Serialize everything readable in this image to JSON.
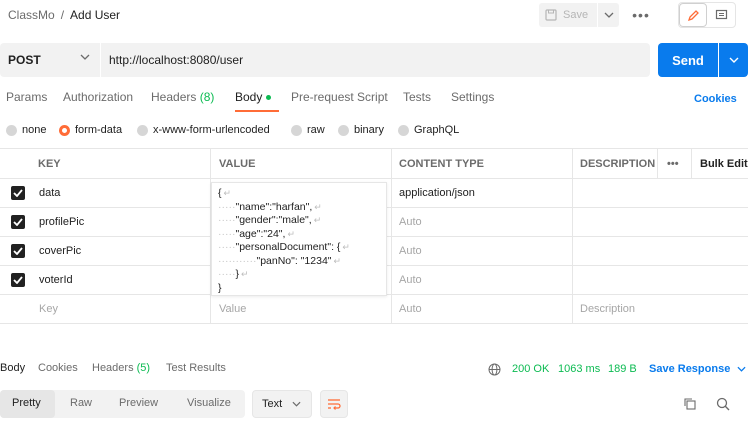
{
  "breadcrumb": {
    "collection": "ClassMo",
    "separator": "/",
    "request": "Add User"
  },
  "toolbar": {
    "save_label": "Save",
    "more": "•••"
  },
  "request": {
    "method": "POST",
    "url": "http://localhost:8080/user",
    "send_label": "Send"
  },
  "tabs": [
    {
      "label": "Params"
    },
    {
      "label": "Authorization"
    },
    {
      "label": "Headers",
      "count": "(8)"
    },
    {
      "label": "Body"
    },
    {
      "label": "Pre-request Script"
    },
    {
      "label": "Tests"
    },
    {
      "label": "Settings"
    }
  ],
  "cookies_label": "Cookies",
  "body_types": [
    {
      "label": "none",
      "selected": false
    },
    {
      "label": "form-data",
      "selected": true
    },
    {
      "label": "x-www-form-urlencoded",
      "selected": false
    },
    {
      "label": "raw",
      "selected": false
    },
    {
      "label": "binary",
      "selected": false
    },
    {
      "label": "GraphQL",
      "selected": false
    }
  ],
  "table": {
    "headers": {
      "key": "KEY",
      "value": "VALUE",
      "content_type": "CONTENT TYPE",
      "description": "DESCRIPTION",
      "more": "•••",
      "bulk_edit": "Bulk Edit"
    },
    "rows": [
      {
        "key": "data",
        "content_type": "application/json",
        "checked": true
      },
      {
        "key": "profilePic",
        "content_type": "Auto",
        "checked": true
      },
      {
        "key": "coverPic",
        "content_type": "Auto",
        "checked": true
      },
      {
        "key": "voterId",
        "content_type": "Auto",
        "checked": true
      }
    ],
    "placeholders": {
      "key": "Key",
      "value": "Value",
      "content_type": "Auto",
      "description": "Description"
    }
  },
  "json_value": {
    "line1": "{",
    "line2": "\"name\":\"harfan\",",
    "line3": "\"gender\":\"male\",",
    "line4": "\"age\":\"24\",",
    "line5": "\"personalDocument\": {",
    "line6": "\"panNo\": \"1234\"",
    "line7": "}",
    "line8": "}"
  },
  "response": {
    "tabs": [
      {
        "label": "Body"
      },
      {
        "label": "Cookies"
      },
      {
        "label": "Headers",
        "count": "(5)"
      },
      {
        "label": "Test Results"
      }
    ],
    "status": "200 OK",
    "time": "1063 ms",
    "size": "189 B",
    "save_label": "Save Response",
    "formats": [
      "Pretty",
      "Raw",
      "Preview",
      "Visualize"
    ],
    "text_select": "Text"
  },
  "colors": {
    "accent": "#ff6c37",
    "primary": "#097bed",
    "success": "#0cbb52"
  }
}
